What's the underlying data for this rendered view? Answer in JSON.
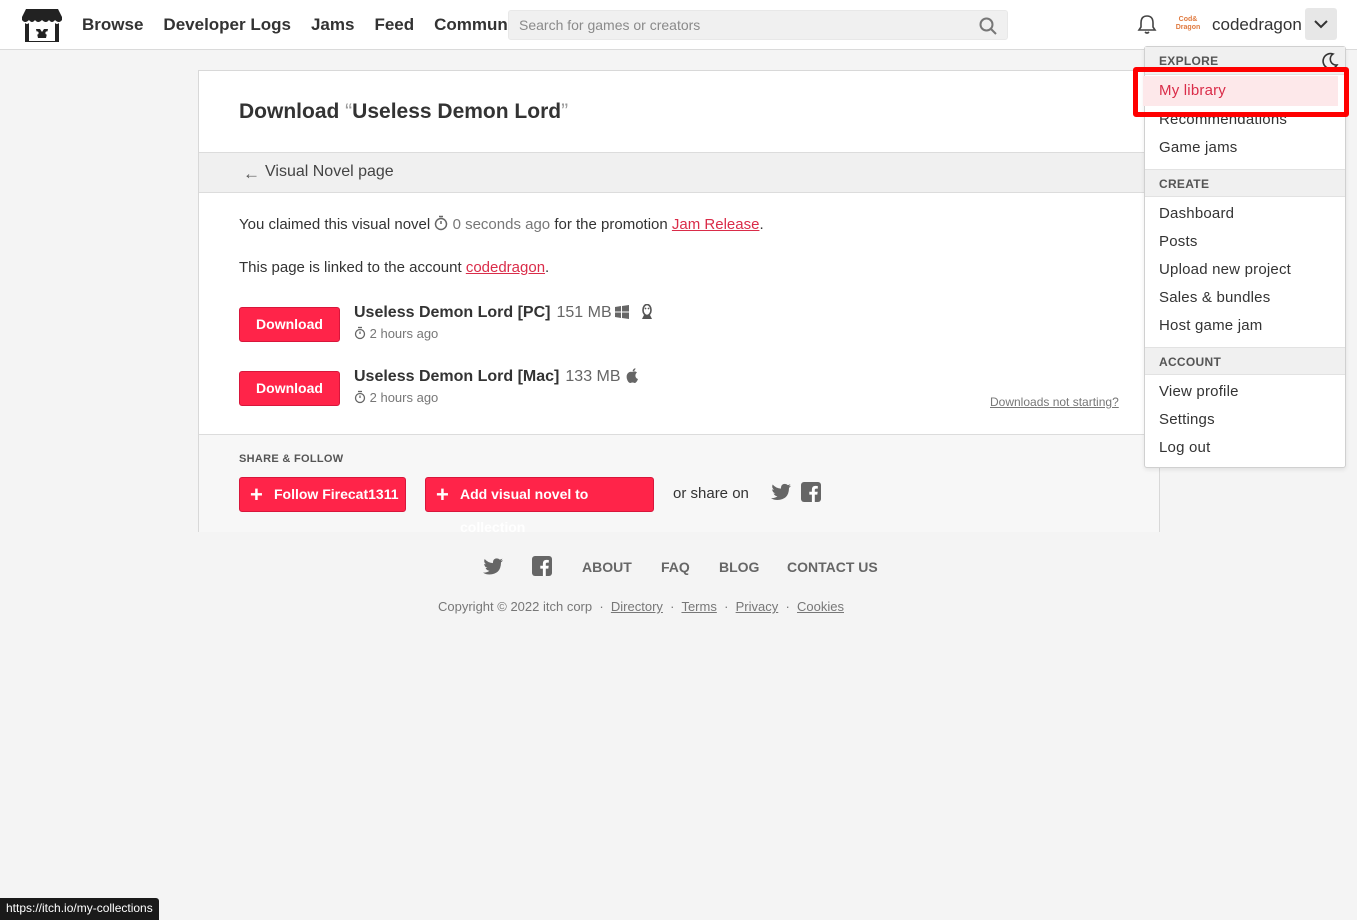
{
  "header": {
    "nav": [
      "Browse",
      "Developer Logs",
      "Jams",
      "Feed",
      "Community"
    ],
    "search_placeholder": "Search for games or creators",
    "avatar_text": "Cod& Dragon",
    "username": "codedragon"
  },
  "dropdown": {
    "explore_label": "EXPLORE",
    "explore_items": [
      "My library",
      "Recommendations",
      "Game jams"
    ],
    "create_label": "CREATE",
    "create_items": [
      "Dashboard",
      "Posts",
      "Upload new project",
      "Sales & bundles",
      "Host game jam"
    ],
    "account_label": "ACCOUNT",
    "account_items": [
      "View profile",
      "Settings",
      "Log out"
    ]
  },
  "page": {
    "title_prefix": "Download ",
    "title_open_quote": "“",
    "title_name": "Useless Demon Lord",
    "title_close_quote": "”",
    "back_label": "Visual Novel page",
    "claimed_prefix": "You claimed this visual novel",
    "claimed_time": "0 seconds ago",
    "claimed_middle": "for the promotion",
    "promotion_link": "Jam Release",
    "claimed_suffix": ".",
    "linked_prefix": "This page is linked to the account",
    "linked_account": "codedragon",
    "linked_suffix": ".",
    "downloads": [
      {
        "button": "Download",
        "name": "Useless Demon Lord [PC]",
        "size": "151 MB",
        "time": "2 hours ago"
      },
      {
        "button": "Download",
        "name": "Useless Demon Lord [Mac]",
        "size": "133 MB",
        "time": "2 hours ago"
      }
    ],
    "downloads_not_starting": "Downloads not starting?",
    "share_heading": "SHARE & FOLLOW",
    "follow_button": "Follow Firecat1311",
    "collection_button": "Add visual novel to collection",
    "or_share": "or share on"
  },
  "footer": {
    "links": [
      "ABOUT",
      "FAQ",
      "BLOG",
      "CONTACT US"
    ],
    "copyright": "Copyright © 2022 itch corp",
    "legal": [
      "Directory",
      "Terms",
      "Privacy",
      "Cookies"
    ]
  },
  "status_url": "https://itch.io/my-collections",
  "colors": {
    "accent": "#ff2449",
    "link": "#da2c49",
    "highlight": "#ff0000"
  }
}
